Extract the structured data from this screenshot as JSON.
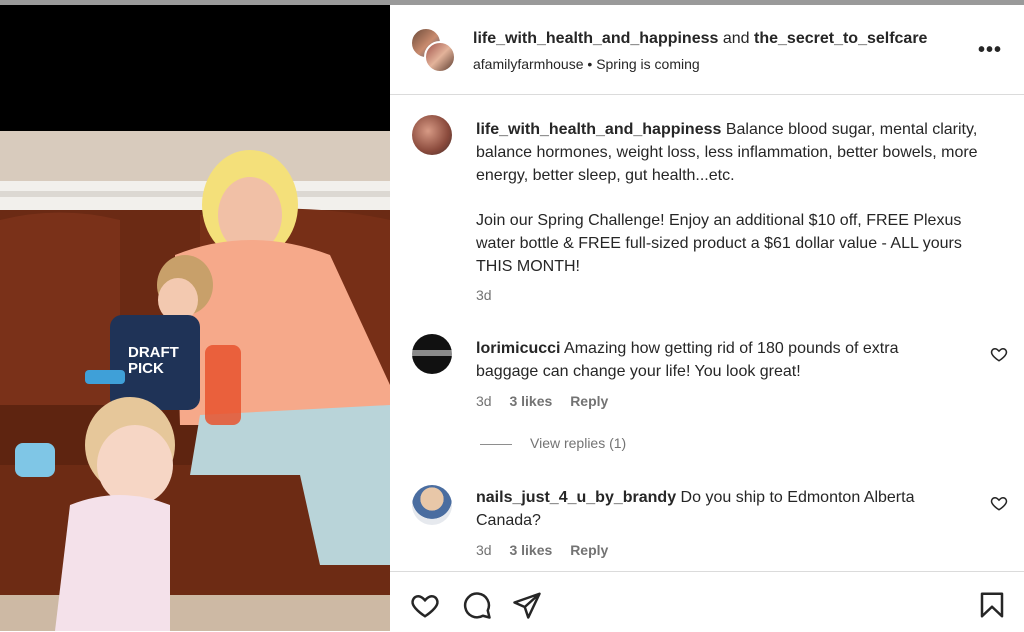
{
  "header": {
    "author1": "life_with_health_and_happiness",
    "joiner": "and",
    "author2": "the_secret_to_selfcare",
    "location_user": "afamilyfarmhouse",
    "separator": "•",
    "audio": "Spring is coming",
    "more_label": "•••"
  },
  "caption": {
    "username": "life_with_health_and_happiness",
    "text1": "Balance blood sugar, mental clarity, balance hormones, weight loss, less inflammation, better bowels, more energy, better sleep, gut health...etc.",
    "text2": "Join our Spring Challenge! Enjoy an additional $10 off, FREE Plexus water bottle & FREE full-sized product a $61 dollar value - ALL yours THIS MONTH!",
    "time": "3d"
  },
  "comments": [
    {
      "username": "lorimicucci",
      "text": "Amazing how getting rid of 180 pounds of extra baggage can change your life! You look great!",
      "time": "3d",
      "likes": "3 likes",
      "reply": "Reply",
      "view_replies": "View replies (1)"
    },
    {
      "username": "nails_just_4_u_by_brandy",
      "text": "Do you ship to Edmonton Alberta Canada?",
      "time": "3d",
      "likes": "3 likes",
      "reply": "Reply"
    }
  ],
  "photo": {
    "shirt_text": "DRAFT PICK"
  },
  "icons": [
    "heart-icon",
    "comment-icon",
    "share-icon",
    "bookmark-icon",
    "more-icon"
  ],
  "colors": {
    "text": "#262626",
    "muted": "#737373",
    "divider": "#dbdbdb"
  }
}
